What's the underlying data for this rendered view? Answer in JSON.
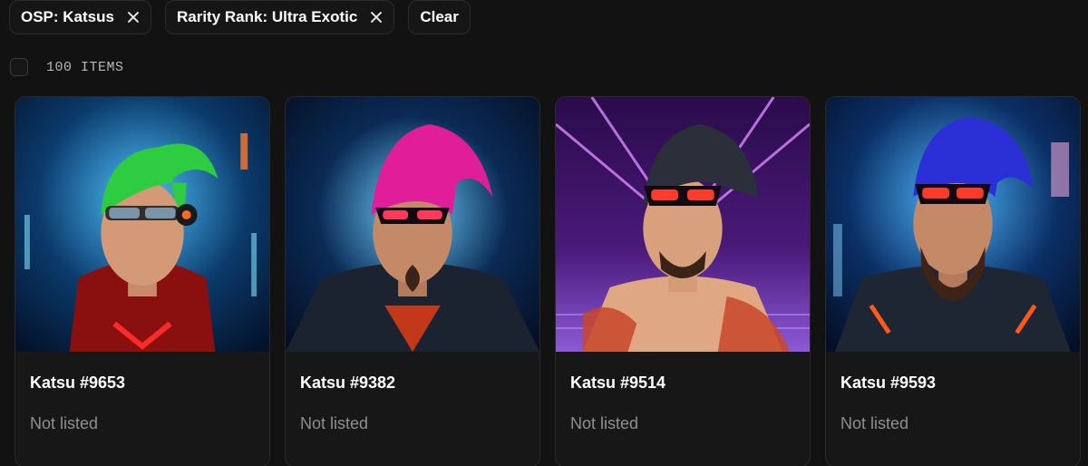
{
  "filters": {
    "chips": [
      {
        "label": "OSP: Katsus"
      },
      {
        "label": "Rarity Rank: Ultra Exotic"
      }
    ],
    "clear_label": "Clear"
  },
  "results": {
    "count_label": "100 ITEMS"
  },
  "cards": [
    {
      "title": "Katsu #9653",
      "status": "Not listed",
      "hair_color": "#2ecc40",
      "bg_color": "#0b3a6b",
      "accent": "#ff2a2a"
    },
    {
      "title": "Katsu #9382",
      "status": "Not listed",
      "hair_color": "#e01e9a",
      "bg_color": "#0a2a55",
      "accent": "#ff4a1a"
    },
    {
      "title": "Katsu #9514",
      "status": "Not listed",
      "hair_color": "#2a2f3a",
      "bg_color": "#4b1a7a",
      "accent": "#ff3b2b"
    },
    {
      "title": "Katsu #9593",
      "status": "Not listed",
      "hair_color": "#2a2fd6",
      "bg_color": "#0b2f66",
      "accent": "#ff5a1a"
    }
  ]
}
